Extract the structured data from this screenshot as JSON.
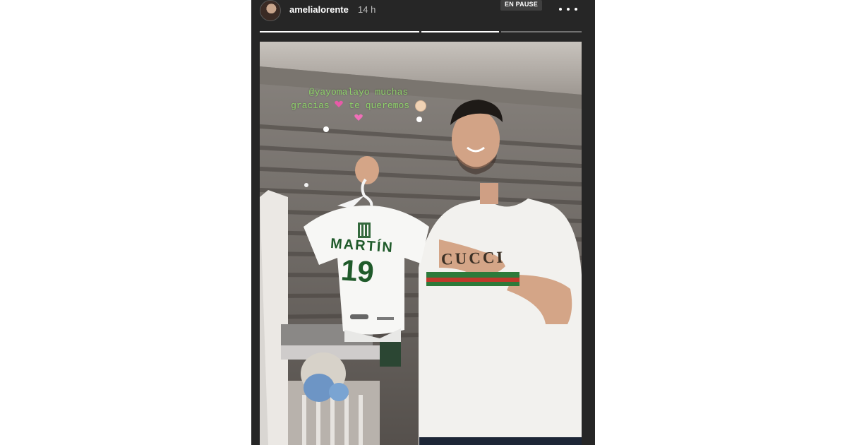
{
  "story": {
    "username": "amelialorente",
    "time_ago": "14 h",
    "paused_badge": "EN PAUSE",
    "more_icon": "more-horizontal-icon",
    "progress": [
      {
        "fraction": 1.0
      },
      {
        "fraction": 1.0
      },
      {
        "fraction": 0.0
      }
    ],
    "caption": {
      "line1": "@yayomalayo muchas",
      "line2_a": "gracias",
      "line2_b": "te queremos",
      "icons": [
        "sparkling-heart-icon",
        "baby-icon",
        "two-hearts-icon"
      ]
    },
    "photo": {
      "jersey_name": "MARTÍN",
      "jersey_number": "19",
      "tshirt_brand": "CUCCI"
    },
    "colors": {
      "caption_text": "#8fd26b",
      "story_bg": "#262626",
      "jersey_text": "#1f5a2a"
    }
  }
}
